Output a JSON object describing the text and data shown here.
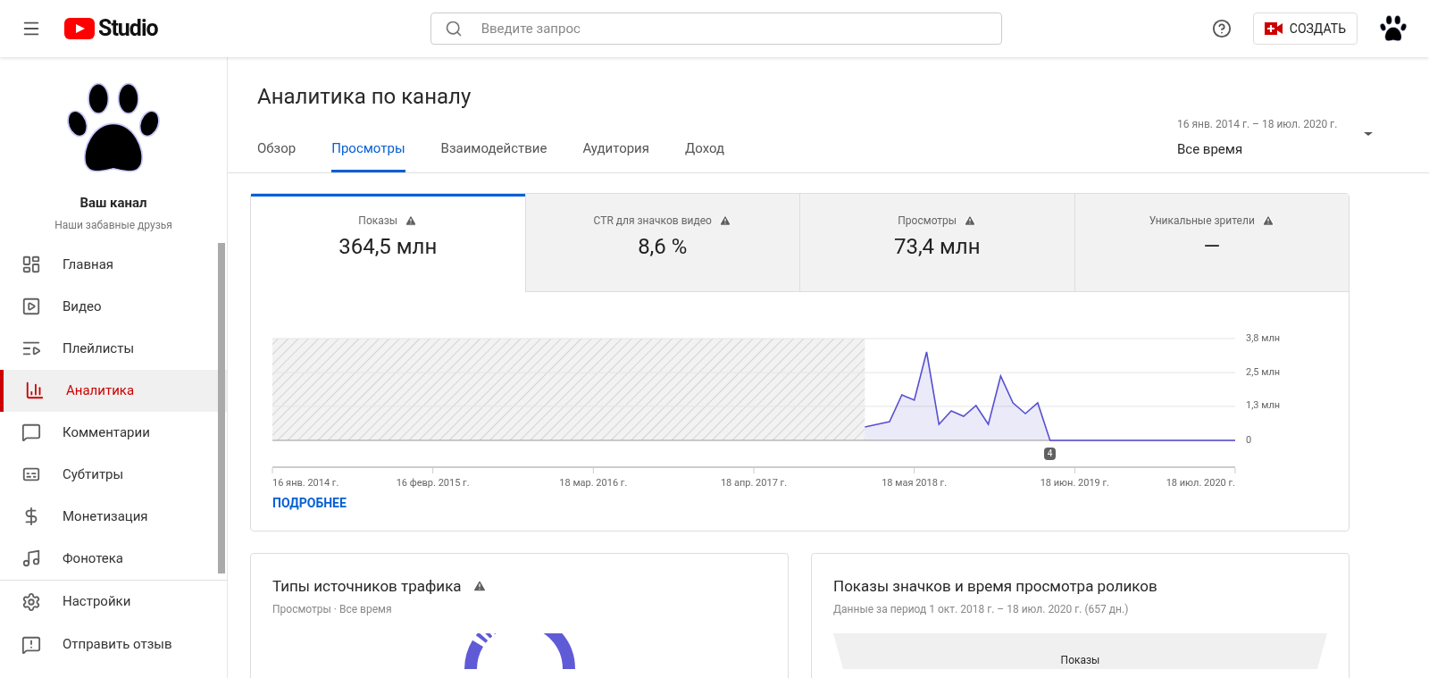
{
  "header": {
    "logo_text": "Studio",
    "search": {
      "placeholder": "Введите запрос"
    },
    "create_button": "СОЗДАТЬ"
  },
  "sidebar": {
    "channel_name": "Ваш канал",
    "channel_subtitle": "Наши забавные друзья",
    "items": [
      {
        "label": "Главная",
        "kind": "dashboard",
        "selected": false
      },
      {
        "label": "Видео",
        "kind": "video",
        "selected": false
      },
      {
        "label": "Плейлисты",
        "kind": "playlist",
        "selected": false
      },
      {
        "label": "Аналитика",
        "kind": "analytics",
        "selected": true
      },
      {
        "label": "Комментарии",
        "kind": "comments",
        "selected": false
      },
      {
        "label": "Субтитры",
        "kind": "subtitles",
        "selected": false
      },
      {
        "label": "Монетизация",
        "kind": "money",
        "selected": false
      },
      {
        "label": "Фонотека",
        "kind": "music",
        "selected": false
      }
    ],
    "footer_items": [
      {
        "label": "Настройки",
        "kind": "settings"
      },
      {
        "label": "Отправить отзыв",
        "kind": "feedback"
      }
    ]
  },
  "page": {
    "title": "Аналитика по каналу",
    "tabs": [
      {
        "label": "Обзор",
        "selected": false
      },
      {
        "label": "Просмотры",
        "selected": true
      },
      {
        "label": "Взаимодействие",
        "selected": false
      },
      {
        "label": "Аудитория",
        "selected": false
      },
      {
        "label": "Доход",
        "selected": false
      }
    ],
    "date_range": {
      "range": "16 янв. 2014 г. – 18 июл. 2020 г.",
      "value": "Все время"
    }
  },
  "metrics": [
    {
      "label": "Показы",
      "value": "364,5 млн",
      "selected": true
    },
    {
      "label": "CTR для значков видео",
      "value": "8,6 %",
      "selected": false
    },
    {
      "label": "Просмотры",
      "value": "73,4 млн",
      "selected": false
    },
    {
      "label": "Уникальные зрители",
      "value": "—",
      "selected": false
    }
  ],
  "chart_data": {
    "type": "area",
    "categories": [
      "16 янв. 2014 г.",
      null,
      null,
      null,
      null,
      null,
      null,
      null,
      null,
      null,
      null,
      null,
      null,
      "16 февр. 2015 г.",
      null,
      null,
      null,
      null,
      null,
      null,
      null,
      null,
      null,
      null,
      null,
      null,
      "18 мар. 2016 г.",
      null,
      null,
      null,
      null,
      null,
      null,
      null,
      null,
      null,
      null,
      null,
      null,
      "18 апр. 2017 г.",
      null,
      null,
      null,
      null,
      null,
      null,
      null,
      null,
      null,
      null,
      null,
      null,
      "18 мая 2018 г.",
      null,
      null,
      null,
      null,
      null,
      null,
      null,
      null,
      null,
      null,
      null,
      null,
      "18 июн. 2019 г.",
      null,
      null,
      null,
      null,
      null,
      null,
      null,
      null,
      null,
      null,
      null,
      null,
      "18 июл. 2020 г."
    ],
    "series": [
      {
        "color": "#5750d1",
        "values": [
          null,
          null,
          null,
          null,
          null,
          null,
          null,
          null,
          null,
          null,
          null,
          null,
          null,
          null,
          null,
          null,
          null,
          null,
          null,
          null,
          null,
          null,
          null,
          null,
          null,
          null,
          null,
          null,
          null,
          null,
          null,
          null,
          null,
          null,
          null,
          null,
          null,
          null,
          null,
          null,
          null,
          null,
          null,
          null,
          null,
          null,
          null,
          null,
          0.5,
          0.6,
          0.7,
          1.7,
          1.5,
          3.3,
          0.6,
          1.1,
          0.9,
          1.3,
          0.6,
          2.4,
          1.4,
          1.0,
          1.4,
          0,
          0,
          0,
          0,
          0,
          0,
          0,
          0,
          0,
          0,
          0,
          0,
          0,
          0,
          0,
          0
        ]
      }
    ],
    "ylim": [
      0,
      3.8
    ],
    "yticks": [
      {
        "value": 0,
        "label": "0"
      },
      {
        "value": 1.27,
        "label": "1,3 млн"
      },
      {
        "value": 2.53,
        "label": "2,5 млн"
      },
      {
        "value": 3.8,
        "label": "3,8 млн"
      }
    ],
    "annotations": [
      "4"
    ]
  },
  "more_link": "ПОДРОБНЕЕ",
  "traffic_card": {
    "title": "Типы источников трафика",
    "subtitle": "Просмотры · Все время"
  },
  "funnel_card": {
    "title": "Показы значков и время просмотра роликов",
    "subtitle": "Данные за период 1 окт. 2018 г. – 18 июл. 2020 г. (657 дн.)",
    "funnel_label": "Показы"
  }
}
